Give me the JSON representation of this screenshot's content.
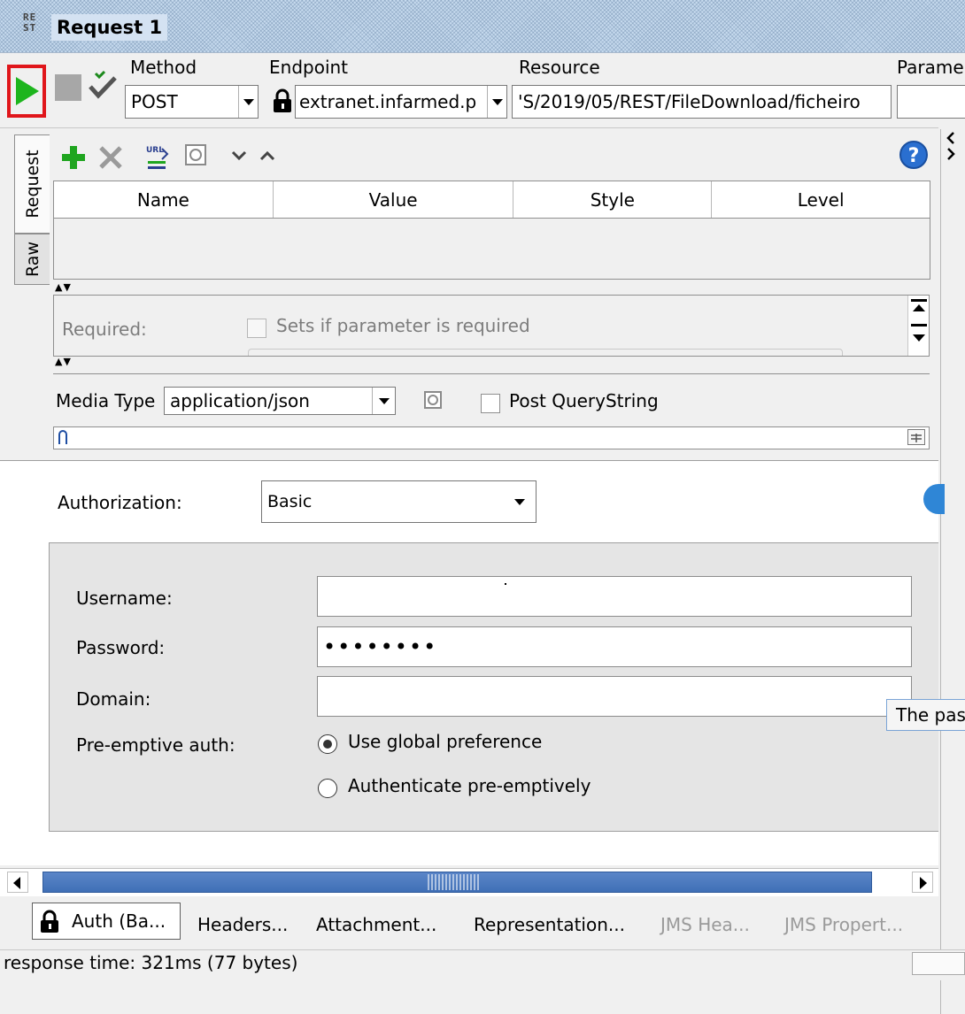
{
  "window": {
    "logo": "REST",
    "title": "Request 1"
  },
  "toolbar": {
    "method_label": "Method",
    "method_value": "POST",
    "endpoint_label": "Endpoint",
    "endpoint_value": "extranet.infarmed.p",
    "resource_label": "Resource",
    "resource_value": "'S/2019/05/REST/FileDownload/ficheiro",
    "params_label": "Parame"
  },
  "request_panel": {
    "vertical_tabs": [
      "Request",
      "Raw"
    ],
    "table_headers": [
      "Name",
      "Value",
      "Style",
      "Level"
    ],
    "required_label": "Required:",
    "required_desc": "Sets if parameter is required",
    "media_type_label": "Media Type",
    "media_type_value": "application/json",
    "post_querystring_label": "Post QueryString"
  },
  "auth": {
    "label": "Authorization:",
    "type_value": "Basic",
    "username_label": "Username:",
    "username_value": "",
    "password_label": "Password:",
    "password_value": "••••••••",
    "domain_label": "Domain:",
    "domain_value": "",
    "preemptive_label": "Pre-emptive auth:",
    "preemptive_options": [
      "Use global preference",
      "Authenticate pre-emptively"
    ],
    "preemptive_selected": "Use global preference",
    "tooltip": "The pas"
  },
  "bottom_tabs": [
    "Auth (Ba...",
    "Headers...",
    "Attachment...",
    "Representation...",
    "JMS Hea...",
    "JMS Propert..."
  ],
  "status": {
    "text": "response time: 321ms (77 bytes)"
  },
  "colors": {
    "run_green": "#1db51d",
    "highlight_red": "#e0161b",
    "add_green": "#1fa51f",
    "scroll_blue": "#4a7bc0"
  }
}
